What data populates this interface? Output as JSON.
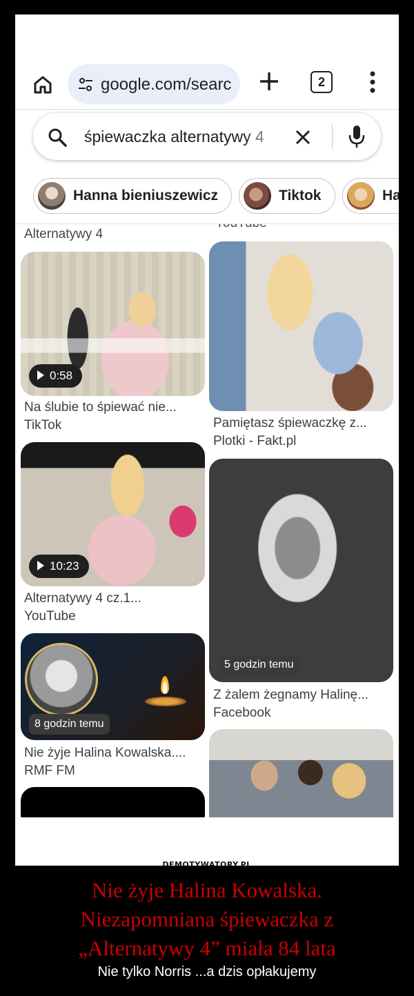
{
  "browser": {
    "url": "google.com/searc",
    "tab_count": "2"
  },
  "search": {
    "query": "śpiewaczka alternatywy 4"
  },
  "chips": [
    {
      "label": "Hanna bieniuszewicz"
    },
    {
      "label": "Tiktok"
    },
    {
      "label": "Ha"
    }
  ],
  "results": {
    "left": {
      "top_label": "Alternatywy 4",
      "items": [
        {
          "duration": "0:58",
          "title": "Na ślubie to śpiewać nie...",
          "source": "TikTok"
        },
        {
          "duration": "10:23",
          "title": "Alternatywy 4 cz.1...",
          "source": "YouTube"
        },
        {
          "badge": "8 godzin temu",
          "title": "Nie żyje Halina Kowalska....",
          "source": "RMF FM"
        }
      ]
    },
    "right": {
      "top_label": "YouTube",
      "items": [
        {
          "title": "Pamiętasz śpiewaczkę z...",
          "source": "Plotki - Fakt.pl"
        },
        {
          "badge": "5 godzin temu",
          "title": "Z żalem żegnamy Halinę...",
          "source": "Facebook"
        }
      ]
    }
  },
  "watermark": "DEMOTYWATORY.PL",
  "caption": {
    "lines": [
      "Nie żyje Halina Kowalska.",
      "Niezapomniana śpiewaczka z",
      "„Alternatywy 4” miała 84 lata"
    ],
    "subtitle": "Nie tylko Norris ...a dzis opłakujemy"
  },
  "colors": {
    "caption_red": "#cc0000",
    "url_pill": "#e9eef9"
  }
}
